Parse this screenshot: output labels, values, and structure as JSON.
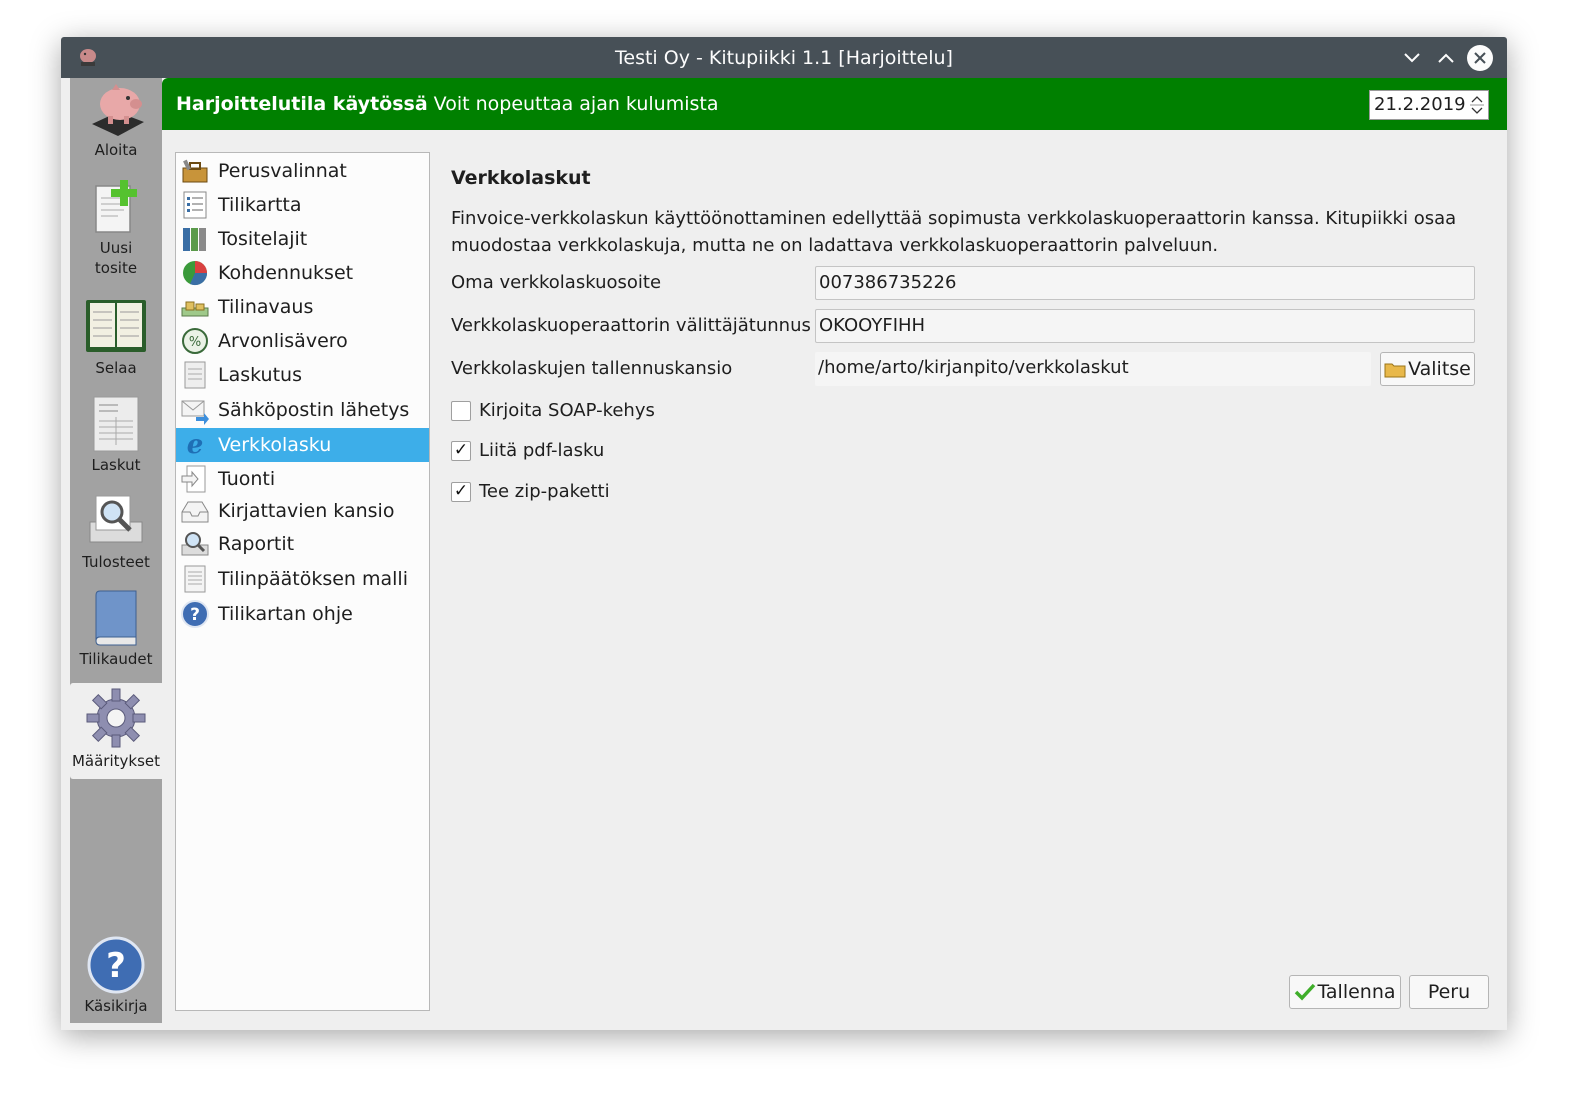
{
  "window": {
    "title": "Testi Oy - Kitupiikki 1.1 [Harjoittelu]"
  },
  "sidebar": {
    "items": [
      {
        "label": "Aloita",
        "icon": "piggy-bank-icon"
      },
      {
        "label": "Uusi\ntosite",
        "icon": "new-document-icon"
      },
      {
        "label": "Selaa",
        "icon": "ledger-book-icon"
      },
      {
        "label": "Laskut",
        "icon": "invoice-icon"
      },
      {
        "label": "Tulosteet",
        "icon": "print-preview-icon"
      },
      {
        "label": "Tilikaudet",
        "icon": "book-icon"
      },
      {
        "label": "Määritykset",
        "icon": "gear-icon"
      },
      {
        "label": "Käsikirja",
        "icon": "help-icon"
      }
    ]
  },
  "banner": {
    "bold": "Harjoittelutila käytössä",
    "text": " Voit nopeuttaa ajan kulumista",
    "date": "21.2.2019",
    "color": "#008000"
  },
  "nav": {
    "items": [
      {
        "label": "Perusvalinnat",
        "icon": "toolbox-icon"
      },
      {
        "label": "Tilikartta",
        "icon": "list-icon"
      },
      {
        "label": "Tositelajit",
        "icon": "binders-icon"
      },
      {
        "label": "Kohdennukset",
        "icon": "pie-chart-icon"
      },
      {
        "label": "Tilinavaus",
        "icon": "money-icon"
      },
      {
        "label": "Arvonlisävero",
        "icon": "tax-icon"
      },
      {
        "label": "Laskutus",
        "icon": "invoice-doc-icon"
      },
      {
        "label": "Sähköpostin lähetys",
        "icon": "email-send-icon"
      },
      {
        "label": "Verkkolasku",
        "icon": "e-invoice-icon"
      },
      {
        "label": "Tuonti",
        "icon": "import-icon"
      },
      {
        "label": "Kirjattavien kansio",
        "icon": "inbox-folder-icon"
      },
      {
        "label": "Raportit",
        "icon": "report-icon"
      },
      {
        "label": "Tilinpäätöksen malli",
        "icon": "document-icon"
      },
      {
        "label": "Tilikartan ohje",
        "icon": "help-icon"
      }
    ],
    "selected_index": 8,
    "selected_color": "#3daee9"
  },
  "content": {
    "heading": "Verkkolaskut",
    "description": "Finvoice-verkkolaskun käyttöönottaminen edellyttää sopimusta verkkolaskuoperaattorin kanssa. Kitupiikki osaa muodostaa verkkolaskuja, mutta ne on ladattava verkkolaskuoperaattorin palveluun.",
    "fields": {
      "address_label": "Oma verkkolaskuosoite",
      "address_value": "007386735226",
      "operator_label": "Verkkolaskuoperaattorin välittäjätunnus",
      "operator_value": "OKOOYFIHH",
      "folder_label": "Verkkolaskujen tallennuskansio",
      "folder_value": "/home/arto/kirjanpito/verkkolaskut",
      "choose_button": "Valitse"
    },
    "checkboxes": [
      {
        "label": "Kirjoita SOAP-kehys",
        "checked": false
      },
      {
        "label": "Liitä pdf-lasku",
        "checked": true
      },
      {
        "label": "Tee zip-paketti",
        "checked": true
      }
    ],
    "buttons": {
      "save": "Tallenna",
      "cancel": "Peru"
    }
  }
}
